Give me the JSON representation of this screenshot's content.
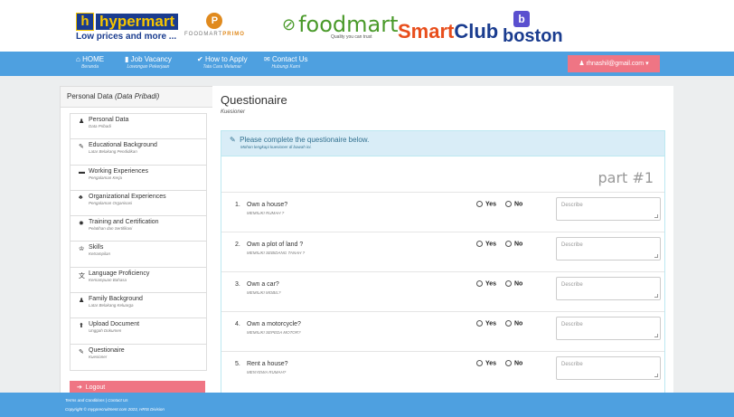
{
  "logos": {
    "hypermart": {
      "mark": "h",
      "name": "hypermart",
      "tagline": "Low prices and more ..."
    },
    "foodmart_primo": {
      "mark": "P",
      "name_a": "FOODMART",
      "name_b": "PRIMO"
    },
    "foodmart": {
      "name": "foodmart",
      "tagline": "Quality you can trust"
    },
    "smartclub": {
      "name_a": "Smart",
      "name_b": "Club"
    },
    "boston": {
      "mark": "b",
      "name": "boston"
    }
  },
  "nav": {
    "items": [
      {
        "icon": "home-icon",
        "glyph": "⌂",
        "label": "HOME",
        "sub": "Beranda"
      },
      {
        "icon": "bookmark-icon",
        "glyph": "▮",
        "label": "Job Vacancy",
        "sub": "Lowongan Pekerjaan"
      },
      {
        "icon": "check-icon",
        "glyph": "✔",
        "label": "How to Apply",
        "sub": "Tata Cara Melamar"
      },
      {
        "icon": "envelope-icon",
        "glyph": "✉",
        "label": "Contact Us",
        "sub": "Hubungi Kami"
      }
    ],
    "user": "rhnashil@gmail.com",
    "user_icon": "user-icon",
    "user_glyph": "👤"
  },
  "sidebar": {
    "title": "Personal Data",
    "title_italic": "(Data Pribadi)",
    "items": [
      {
        "icon": "user-icon",
        "glyph": "♟",
        "label": "Personal Data",
        "sub": "Data Pribadi"
      },
      {
        "icon": "graduation-cap-icon",
        "glyph": "✎",
        "label": "Educational Background",
        "sub": "Latar Belakang Pendidikan"
      },
      {
        "icon": "briefcase-icon",
        "glyph": "▬",
        "label": "Working Experiences",
        "sub": "Pengalaman Kerja"
      },
      {
        "icon": "sitemap-icon",
        "glyph": "♣",
        "label": "Organizational Experiences",
        "sub": "Pengalaman Organisasi"
      },
      {
        "icon": "certificate-icon",
        "glyph": "✹",
        "label": "Training and Certification",
        "sub": "Pelatihan dan Sertifikasi"
      },
      {
        "icon": "trophy-icon",
        "glyph": "♔",
        "label": "Skills",
        "sub": "Ketrampilan"
      },
      {
        "icon": "language-icon",
        "glyph": "文",
        "label": "Language Proficiency",
        "sub": "Kemampuan Bahasa"
      },
      {
        "icon": "family-icon",
        "glyph": "♟",
        "label": "Family Background",
        "sub": "Latar Belakang Keluarga"
      },
      {
        "icon": "upload-icon",
        "glyph": "⬆",
        "label": "Upload Document",
        "sub": "Unggah Dokumen"
      },
      {
        "icon": "edit-icon",
        "glyph": "✎",
        "label": "Questionaire",
        "sub": "Kuesioner"
      }
    ],
    "logout": "Logout",
    "logout_icon": "logout-icon",
    "logout_glyph": "➔"
  },
  "main": {
    "title": "Questionaire",
    "subtitle": "Kuesioner",
    "alert": "Please complete the questionaire below.",
    "alert_sub": "Mohon lengkapi kuesioner di bawah ini.",
    "alert_icon": "edit-icon",
    "alert_glyph": "✎",
    "part": "part #1",
    "yes": "Yes",
    "no": "No",
    "placeholder": "Describe",
    "questions": [
      {
        "num": "1.",
        "q": "Own a house?",
        "sub": "MEMILIKI RUMAH ?"
      },
      {
        "num": "2.",
        "q": "Own a plot of land ?",
        "sub": "MEMILIKI SEBIDANG TANAH ?"
      },
      {
        "num": "3.",
        "q": "Own a car?",
        "sub": "MEMILIKI MOBIL?"
      },
      {
        "num": "4.",
        "q": "Own a motorcycle?",
        "sub": "MEMILIKI SEPEDA MOTOR?"
      },
      {
        "num": "5.",
        "q": "Rent a house?",
        "sub": "MENYEWA RUMAH?"
      }
    ]
  },
  "footer": {
    "links": "Terms and Conditions  |  Contact Us",
    "copyright": "Copyright © mypprecruitment.com 2023, HRIS Division"
  },
  "colors": {
    "nav": "#4ea0e0",
    "accent": "#ef7584",
    "info": "#d9edf7"
  }
}
